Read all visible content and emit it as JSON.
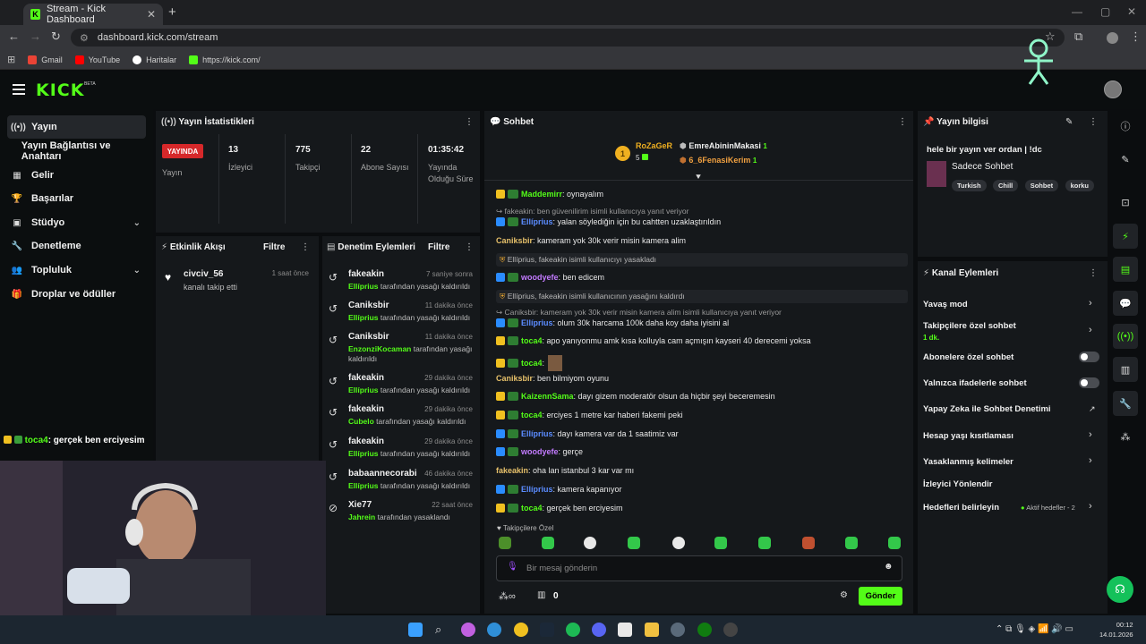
{
  "browser": {
    "tab_title": "Stream - Kick Dashboard",
    "url": "dashboard.kick.com/stream",
    "bookmarks": [
      "Gmail",
      "YouTube",
      "Haritalar",
      "https://kick.com/"
    ]
  },
  "app": {
    "logo": "KICK",
    "beta": "BETA"
  },
  "sidebar": {
    "items": [
      {
        "label": "Yayın",
        "icon": "broadcast-icon"
      },
      {
        "label": "Yayın Bağlantısı ve Anahtarı",
        "icon": "key-icon"
      },
      {
        "label": "Gelir",
        "icon": "revenue-icon"
      },
      {
        "label": "Başarılar",
        "icon": "trophy-icon"
      },
      {
        "label": "Stüdyo",
        "icon": "studio-icon"
      },
      {
        "label": "Denetleme",
        "icon": "wrench-icon"
      },
      {
        "label": "Topluluk",
        "icon": "community-icon"
      },
      {
        "label": "Droplar ve ödüller",
        "icon": "gift-icon"
      }
    ],
    "last_chat": {
      "user": "toca4",
      "text": ": gerçek ben erciyesim"
    }
  },
  "stats": {
    "title": "Yayın İstatistikleri",
    "live_badge": "YAYINDA",
    "live_label": "Yayın",
    "viewers": "13",
    "viewers_label": "İzleyici",
    "followers": "775",
    "followers_label": "Takipçi",
    "subs": "22",
    "subs_label": "Abone Sayısı",
    "duration": "01:35:42",
    "duration_label": "Yayında Olduğu Süre"
  },
  "event_feed": {
    "title": "Etkinlik Akışı",
    "filter": "Filtre",
    "events": [
      {
        "name": "civciv_56",
        "desc": "kanalı takip etti",
        "time": "1 saat önce"
      }
    ]
  },
  "moderation": {
    "title": "Denetim Eylemleri",
    "filter": "Filtre",
    "items": [
      {
        "name": "fakeakin",
        "time": "7 saniye sonra",
        "actor": "Ellíprius",
        "action": " tarafından yasağı kaldırıldı"
      },
      {
        "name": "Caniksbir",
        "time": "11 dakika önce",
        "actor": "Ellíprius",
        "action": " tarafından yasağı kaldırıldı"
      },
      {
        "name": "Caniksbir",
        "time": "11 dakika önce",
        "actor": "EnzonziKocaman",
        "action": " tarafından yasağı kaldırıldı"
      },
      {
        "name": "fakeakin",
        "time": "29 dakika önce",
        "actor": "Ellíprius",
        "action": " tarafından yasağı kaldırıldı"
      },
      {
        "name": "fakeakin",
        "time": "29 dakika önce",
        "actor": "Cubelo",
        "action": " tarafından yasağı kaldırıldı"
      },
      {
        "name": "fakeakin",
        "time": "29 dakika önce",
        "actor": "Ellíprius",
        "action": " tarafından yasağı kaldırıldı"
      },
      {
        "name": "babaannecorabi",
        "time": "46 dakika önce",
        "actor": "Ellíprius",
        "action": " tarafından yasağı kaldırıldı"
      },
      {
        "name": "Xie77",
        "time": "22 saat önce",
        "actor": "Jahrein",
        "action": " tarafından yasaklandı"
      }
    ]
  },
  "chat": {
    "title": "Sohbet",
    "top_users": [
      {
        "name": "RoZaGeR",
        "count": "5"
      },
      {
        "name": "EmreAbininMakasi",
        "count": "1"
      },
      {
        "name": "6_6FenasiKerim",
        "count": "1"
      }
    ],
    "messages": [
      {
        "user": "Maddemirr",
        "text": ": oynayalım",
        "color": "#53fc18",
        "badge": "#f0c020",
        "kind": "msg"
      },
      {
        "text": "↪ fakeakin: ben güvenilirim isimli kullanıcıya yanıt veriyor",
        "kind": "sys"
      },
      {
        "user": "Ellíprius",
        "text": ": yalan söylediğin için bu cahtten uzaklaştırıldın",
        "color": "#5b8cff",
        "badge": "#2a8cff",
        "kind": "msg"
      },
      {
        "user": "Caniksbir",
        "text": ": kameram yok 30k verir misin kamera alim",
        "color": "#e6c06a",
        "badge": "",
        "kind": "msg"
      },
      {
        "text": "Ellíprius, fakeakin isimli kullanıcıyı yasakladı",
        "kind": "sysbg"
      },
      {
        "user": "woodyefe",
        "text": ": ben edicem",
        "color": "#c37bff",
        "badge": "#2a8cff",
        "kind": "msg"
      },
      {
        "text": "Ellíprius, fakeakin isimli kullanıcının yasağını kaldırdı",
        "kind": "sysbg"
      },
      {
        "text": "↪ Caniksbir: kameram yok 30k verir misin kamera alim isimli kullanıcıya yanıt veriyor",
        "kind": "sys"
      },
      {
        "user": "Ellíprius",
        "text": ": olum 30k harcama 100k daha koy daha iyisini al",
        "color": "#5b8cff",
        "badge": "#2a8cff",
        "kind": "msg"
      },
      {
        "user": "toca4",
        "text": ": apo yanıyonmu amk kısa kolluyla cam açmışın kayseri 40 derecemi yoksa",
        "color": "#53fc18",
        "badge": "#f0c020",
        "kind": "msg"
      },
      {
        "user": "toca4",
        "text": ":",
        "color": "#53fc18",
        "badge": "#f0c020",
        "kind": "msg"
      },
      {
        "user": "Caniksbir",
        "text": ": ben bilmiyom oyunu",
        "color": "#e6c06a",
        "badge": "",
        "kind": "msg"
      },
      {
        "user": "KaizennSama",
        "text": ": dayı gizem moderatör olsun da hiçbir şeyi beceremesin",
        "color": "#53fc18",
        "badge": "#f0c020",
        "kind": "msg"
      },
      {
        "user": "toca4",
        "text": ": erciyes 1 metre kar haberi fakemi peki",
        "color": "#53fc18",
        "badge": "#f0c020",
        "kind": "msg"
      },
      {
        "user": "Ellíprius",
        "text": ": dayı kamera var da 1 saatimiz var",
        "color": "#5b8cff",
        "badge": "#2a8cff",
        "kind": "msg"
      },
      {
        "user": "woodyefe",
        "text": ": gerçe",
        "color": "#c37bff",
        "badge": "#2a8cff",
        "kind": "msg"
      },
      {
        "user": "fakeakin",
        "text": ": oha lan istanbul 3 kar var mı",
        "color": "#e6c06a",
        "badge": "",
        "kind": "msg"
      },
      {
        "user": "Ellíprius",
        "text": ": kamera kapanıyor",
        "color": "#5b8cff",
        "badge": "#2a8cff",
        "kind": "msg"
      },
      {
        "user": "toca4",
        "text": ": gerçek ben erciyesim",
        "color": "#53fc18",
        "badge": "#f0c020",
        "kind": "msg"
      }
    ],
    "follower_only": "Takipçilere Özel",
    "input_placeholder": "Bir mesaj gönderin",
    "points": "0",
    "send": "Gönder"
  },
  "stream_info": {
    "title": "Yayın bilgisi",
    "stream_title": "hele bir yayın ver ordan | !dc",
    "category": "Sadece Sohbet",
    "tags": [
      "Turkish",
      "Chill",
      "Sohbet",
      "korku"
    ]
  },
  "channel_actions": {
    "title": "Kanal Eylemleri",
    "slow_mode": "Yavaş mod",
    "follower_chat": "Takipçilere özel sohbet",
    "follower_chat_sub": "1 dk.",
    "sub_chat": "Abonelere özel sohbet",
    "emote_chat": "Yalnızca ifadelerle sohbet",
    "ai_mod": "Yapay Zeka ile Sohbet Denetimi",
    "age": "Hesap yaşı kısıtlaması",
    "banned_words": "Yasaklanmış kelimeler",
    "redirect": "İzleyici Yönlendir",
    "goals": "Hedefleri belirleyin",
    "goals_status": "Aktif hedefler - 2"
  },
  "clock": {
    "time": "00:12",
    "date": "14.01.2026"
  },
  "colors": {
    "accent": "#53fc18",
    "live": "#d6282a"
  }
}
